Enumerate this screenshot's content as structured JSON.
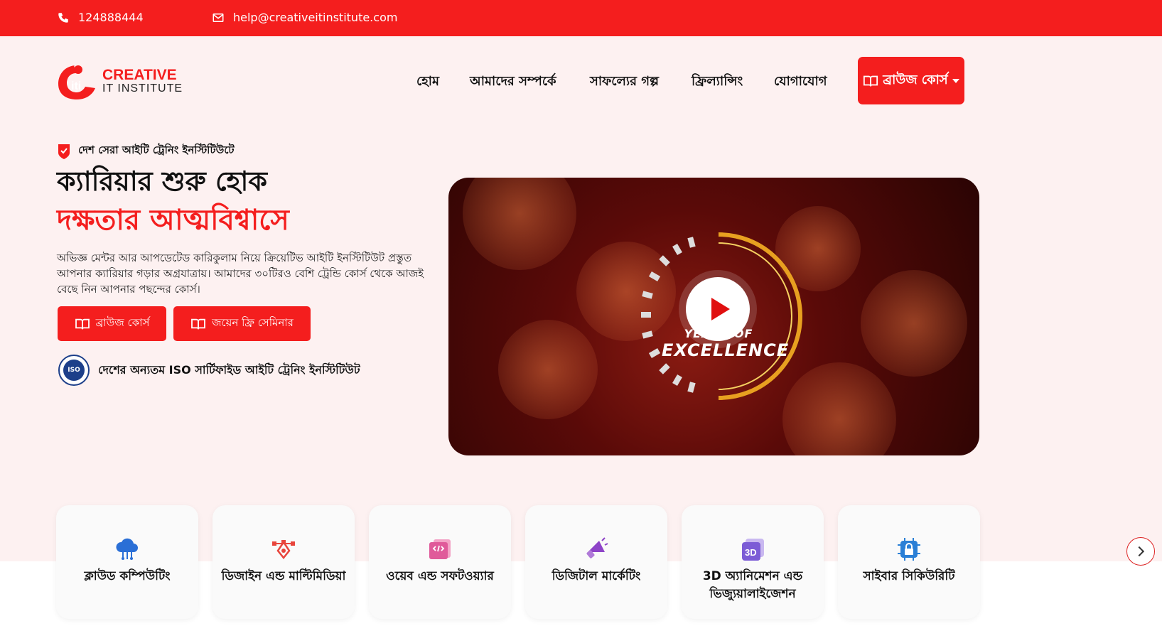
{
  "topbar": {
    "phone": "124888444",
    "email": "help@creativeitinstitute.com"
  },
  "logo": {
    "line1": "CREATIVE",
    "line2": "IT INSTITUTE"
  },
  "nav": {
    "items": [
      "হোম",
      "আমাদের সম্পর্কে",
      "সাফল্যের গল্প",
      "ফ্রিল্যান্সিং",
      "যোগাযোগ"
    ],
    "browse_label": "ব্রাউজ কোর্স"
  },
  "hero": {
    "badge": "দেশ সেরা আইটি ট্রেনিং ইনস্টিটিউটে",
    "headline_1": "ক্যারিয়ার শুরু হোক",
    "headline_2": "দক্ষতার আত্মবিশ্বাসে",
    "description": "অভিজ্ঞ মেন্টর আর আপডেটেড কারিকুলাম নিয়ে ক্রিয়েটিভ আইটি ইনস্টিটিউট প্রস্তুত আপনার ক্যারিয়ার গড়ার অগ্রযাত্রায়। আমাদের ৩০টিরও বেশি ট্রেন্ডি কোর্স থেকে আজই বেছে নিন আপনার পছন্দের কোর্স।",
    "cta_browse": "ব্রাউজ কোর্স",
    "cta_seminar": "জয়েন ফ্রি সেমিনার",
    "iso_seal": "ISO",
    "iso_text": "দেশের অন্যতম ISO সার্টিফাইড আইটি ট্রেনিং ইনস্টিটিউট"
  },
  "video": {
    "caption_1": "YEARS OF",
    "caption_2": "EXCELLENCE"
  },
  "categories": [
    {
      "label": "ক্লাউড কম্পিউটিং",
      "icon": "cloud-icon",
      "color": "#2a6fd6"
    },
    {
      "label": "ডিজাইন এন্ড মাল্টিমিডিয়া",
      "icon": "pen-tool-icon",
      "color": "#e8453c"
    },
    {
      "label": "ওয়েব এন্ড সফটওয়্যার",
      "icon": "code-window-icon",
      "color": "#e05a9a"
    },
    {
      "label": "ডিজিটাল মার্কেটিং",
      "icon": "megaphone-icon",
      "color": "#8e44c8"
    },
    {
      "label": "3D অ্যানিমেশন এন্ড ভিজ্যুয়ালাইজেশন",
      "icon": "3d-box-icon",
      "color": "#7c5cd6"
    },
    {
      "label": "সাইবার সিকিউরিটি",
      "icon": "security-lock-icon",
      "color": "#2a7fd6"
    }
  ],
  "colors": {
    "brand_red": "#f41e1e"
  }
}
